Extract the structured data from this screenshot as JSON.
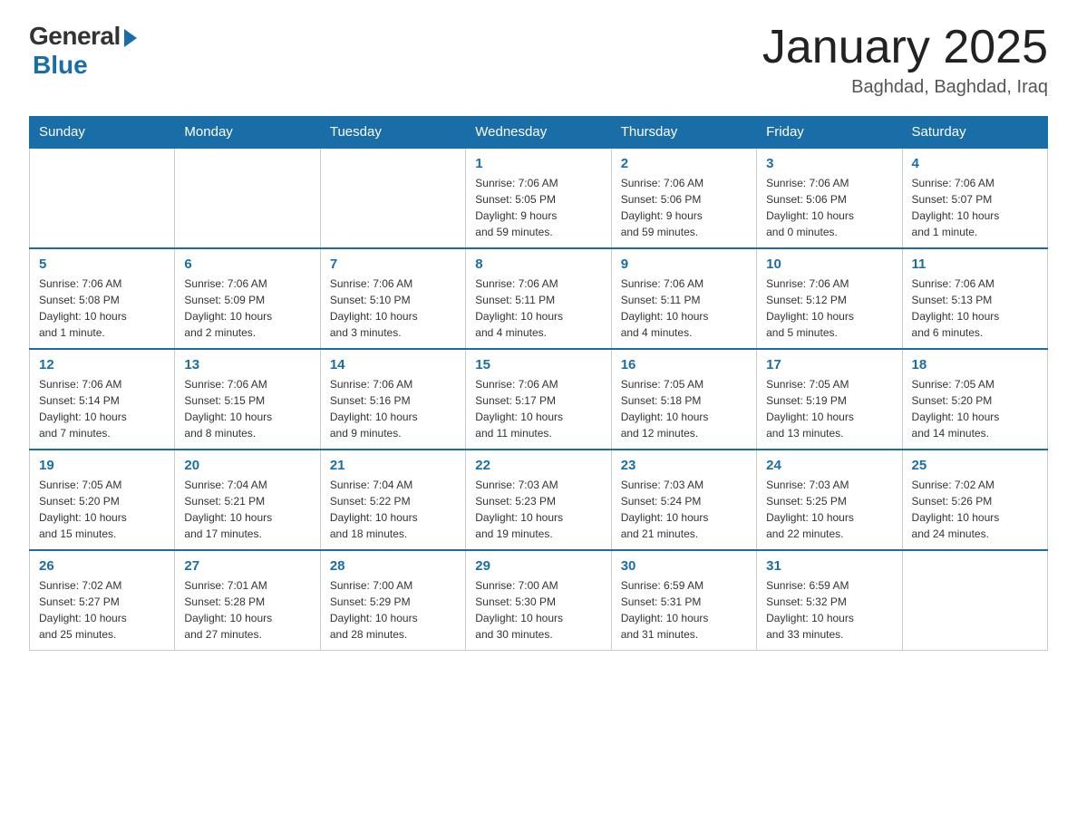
{
  "logo": {
    "general": "General",
    "blue": "Blue"
  },
  "header": {
    "title": "January 2025",
    "subtitle": "Baghdad, Baghdad, Iraq"
  },
  "days": [
    "Sunday",
    "Monday",
    "Tuesday",
    "Wednesday",
    "Thursday",
    "Friday",
    "Saturday"
  ],
  "weeks": [
    [
      {
        "day": "",
        "info": ""
      },
      {
        "day": "",
        "info": ""
      },
      {
        "day": "",
        "info": ""
      },
      {
        "day": "1",
        "info": "Sunrise: 7:06 AM\nSunset: 5:05 PM\nDaylight: 9 hours\nand 59 minutes."
      },
      {
        "day": "2",
        "info": "Sunrise: 7:06 AM\nSunset: 5:06 PM\nDaylight: 9 hours\nand 59 minutes."
      },
      {
        "day": "3",
        "info": "Sunrise: 7:06 AM\nSunset: 5:06 PM\nDaylight: 10 hours\nand 0 minutes."
      },
      {
        "day": "4",
        "info": "Sunrise: 7:06 AM\nSunset: 5:07 PM\nDaylight: 10 hours\nand 1 minute."
      }
    ],
    [
      {
        "day": "5",
        "info": "Sunrise: 7:06 AM\nSunset: 5:08 PM\nDaylight: 10 hours\nand 1 minute."
      },
      {
        "day": "6",
        "info": "Sunrise: 7:06 AM\nSunset: 5:09 PM\nDaylight: 10 hours\nand 2 minutes."
      },
      {
        "day": "7",
        "info": "Sunrise: 7:06 AM\nSunset: 5:10 PM\nDaylight: 10 hours\nand 3 minutes."
      },
      {
        "day": "8",
        "info": "Sunrise: 7:06 AM\nSunset: 5:11 PM\nDaylight: 10 hours\nand 4 minutes."
      },
      {
        "day": "9",
        "info": "Sunrise: 7:06 AM\nSunset: 5:11 PM\nDaylight: 10 hours\nand 4 minutes."
      },
      {
        "day": "10",
        "info": "Sunrise: 7:06 AM\nSunset: 5:12 PM\nDaylight: 10 hours\nand 5 minutes."
      },
      {
        "day": "11",
        "info": "Sunrise: 7:06 AM\nSunset: 5:13 PM\nDaylight: 10 hours\nand 6 minutes."
      }
    ],
    [
      {
        "day": "12",
        "info": "Sunrise: 7:06 AM\nSunset: 5:14 PM\nDaylight: 10 hours\nand 7 minutes."
      },
      {
        "day": "13",
        "info": "Sunrise: 7:06 AM\nSunset: 5:15 PM\nDaylight: 10 hours\nand 8 minutes."
      },
      {
        "day": "14",
        "info": "Sunrise: 7:06 AM\nSunset: 5:16 PM\nDaylight: 10 hours\nand 9 minutes."
      },
      {
        "day": "15",
        "info": "Sunrise: 7:06 AM\nSunset: 5:17 PM\nDaylight: 10 hours\nand 11 minutes."
      },
      {
        "day": "16",
        "info": "Sunrise: 7:05 AM\nSunset: 5:18 PM\nDaylight: 10 hours\nand 12 minutes."
      },
      {
        "day": "17",
        "info": "Sunrise: 7:05 AM\nSunset: 5:19 PM\nDaylight: 10 hours\nand 13 minutes."
      },
      {
        "day": "18",
        "info": "Sunrise: 7:05 AM\nSunset: 5:20 PM\nDaylight: 10 hours\nand 14 minutes."
      }
    ],
    [
      {
        "day": "19",
        "info": "Sunrise: 7:05 AM\nSunset: 5:20 PM\nDaylight: 10 hours\nand 15 minutes."
      },
      {
        "day": "20",
        "info": "Sunrise: 7:04 AM\nSunset: 5:21 PM\nDaylight: 10 hours\nand 17 minutes."
      },
      {
        "day": "21",
        "info": "Sunrise: 7:04 AM\nSunset: 5:22 PM\nDaylight: 10 hours\nand 18 minutes."
      },
      {
        "day": "22",
        "info": "Sunrise: 7:03 AM\nSunset: 5:23 PM\nDaylight: 10 hours\nand 19 minutes."
      },
      {
        "day": "23",
        "info": "Sunrise: 7:03 AM\nSunset: 5:24 PM\nDaylight: 10 hours\nand 21 minutes."
      },
      {
        "day": "24",
        "info": "Sunrise: 7:03 AM\nSunset: 5:25 PM\nDaylight: 10 hours\nand 22 minutes."
      },
      {
        "day": "25",
        "info": "Sunrise: 7:02 AM\nSunset: 5:26 PM\nDaylight: 10 hours\nand 24 minutes."
      }
    ],
    [
      {
        "day": "26",
        "info": "Sunrise: 7:02 AM\nSunset: 5:27 PM\nDaylight: 10 hours\nand 25 minutes."
      },
      {
        "day": "27",
        "info": "Sunrise: 7:01 AM\nSunset: 5:28 PM\nDaylight: 10 hours\nand 27 minutes."
      },
      {
        "day": "28",
        "info": "Sunrise: 7:00 AM\nSunset: 5:29 PM\nDaylight: 10 hours\nand 28 minutes."
      },
      {
        "day": "29",
        "info": "Sunrise: 7:00 AM\nSunset: 5:30 PM\nDaylight: 10 hours\nand 30 minutes."
      },
      {
        "day": "30",
        "info": "Sunrise: 6:59 AM\nSunset: 5:31 PM\nDaylight: 10 hours\nand 31 minutes."
      },
      {
        "day": "31",
        "info": "Sunrise: 6:59 AM\nSunset: 5:32 PM\nDaylight: 10 hours\nand 33 minutes."
      },
      {
        "day": "",
        "info": ""
      }
    ]
  ]
}
